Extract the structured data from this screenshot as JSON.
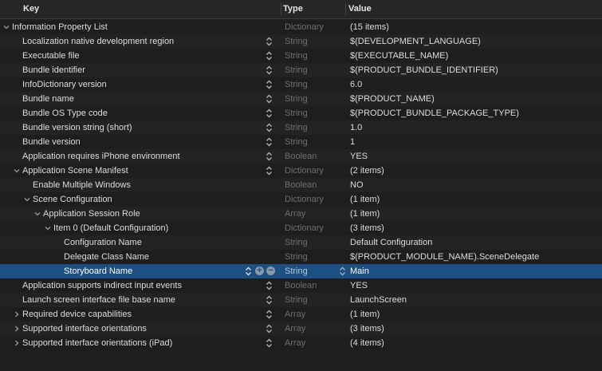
{
  "header": {
    "key": "Key",
    "type": "Type",
    "value": "Value"
  },
  "colors": {
    "background": "#1e1e1f",
    "selection": "#1d4f82",
    "type_text": "#6e6e70"
  },
  "rows": [
    {
      "key": "Information Property List",
      "type": "Dictionary",
      "value": "(15 items)",
      "level": 0,
      "disclosure": "open",
      "stepper": false
    },
    {
      "key": "Localization native development region",
      "type": "String",
      "value": "$(DEVELOPMENT_LANGUAGE)",
      "level": 1,
      "disclosure": "none",
      "stepper": true
    },
    {
      "key": "Executable file",
      "type": "String",
      "value": "$(EXECUTABLE_NAME)",
      "level": 1,
      "disclosure": "none",
      "stepper": true
    },
    {
      "key": "Bundle identifier",
      "type": "String",
      "value": "$(PRODUCT_BUNDLE_IDENTIFIER)",
      "level": 1,
      "disclosure": "none",
      "stepper": true
    },
    {
      "key": "InfoDictionary version",
      "type": "String",
      "value": "6.0",
      "level": 1,
      "disclosure": "none",
      "stepper": true
    },
    {
      "key": "Bundle name",
      "type": "String",
      "value": "$(PRODUCT_NAME)",
      "level": 1,
      "disclosure": "none",
      "stepper": true
    },
    {
      "key": "Bundle OS Type code",
      "type": "String",
      "value": "$(PRODUCT_BUNDLE_PACKAGE_TYPE)",
      "level": 1,
      "disclosure": "none",
      "stepper": true
    },
    {
      "key": "Bundle version string (short)",
      "type": "String",
      "value": "1.0",
      "level": 1,
      "disclosure": "none",
      "stepper": true
    },
    {
      "key": "Bundle version",
      "type": "String",
      "value": "1",
      "level": 1,
      "disclosure": "none",
      "stepper": true
    },
    {
      "key": "Application requires iPhone environment",
      "type": "Boolean",
      "value": "YES",
      "level": 1,
      "disclosure": "none",
      "stepper": true
    },
    {
      "key": "Application Scene Manifest",
      "type": "Dictionary",
      "value": "(2 items)",
      "level": 1,
      "disclosure": "open",
      "stepper": true
    },
    {
      "key": "Enable Multiple Windows",
      "type": "Boolean",
      "value": "NO",
      "level": 2,
      "disclosure": "none",
      "stepper": false
    },
    {
      "key": "Scene Configuration",
      "type": "Dictionary",
      "value": "(1 item)",
      "level": 2,
      "disclosure": "open",
      "stepper": false
    },
    {
      "key": "Application Session Role",
      "type": "Array",
      "value": "(1 item)",
      "level": 3,
      "disclosure": "open",
      "stepper": false
    },
    {
      "key": "Item 0 (Default Configuration)",
      "type": "Dictionary",
      "value": "(3 items)",
      "level": 4,
      "disclosure": "open",
      "stepper": false
    },
    {
      "key": "Configuration Name",
      "type": "String",
      "value": "Default Configuration",
      "level": 5,
      "disclosure": "none",
      "stepper": false
    },
    {
      "key": "Delegate Class Name",
      "type": "String",
      "value": "$(PRODUCT_MODULE_NAME).SceneDelegate",
      "level": 5,
      "disclosure": "none",
      "stepper": false
    },
    {
      "key": "Storyboard Name",
      "type": "String",
      "value": "Main",
      "level": 5,
      "disclosure": "none",
      "stepper": false,
      "selected": true
    },
    {
      "key": "Application supports indirect input events",
      "type": "Boolean",
      "value": "YES",
      "level": 1,
      "disclosure": "none",
      "stepper": true
    },
    {
      "key": "Launch screen interface file base name",
      "type": "String",
      "value": "LaunchScreen",
      "level": 1,
      "disclosure": "none",
      "stepper": true
    },
    {
      "key": "Required device capabilities",
      "type": "Array",
      "value": "(1 item)",
      "level": 1,
      "disclosure": "closed",
      "stepper": true
    },
    {
      "key": "Supported interface orientations",
      "type": "Array",
      "value": "(3 items)",
      "level": 1,
      "disclosure": "closed",
      "stepper": true
    },
    {
      "key": "Supported interface orientations (iPad)",
      "type": "Array",
      "value": "(4 items)",
      "level": 1,
      "disclosure": "closed",
      "stepper": true
    }
  ]
}
